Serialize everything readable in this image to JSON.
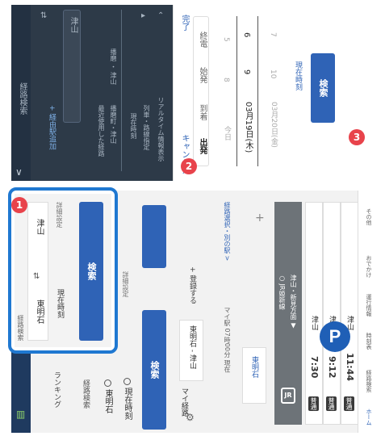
{
  "top": {
    "header_title": "経路検索",
    "add_via_label": "+ 経由駅追加",
    "from_placeholder": "出発",
    "to_value": "津山",
    "recent_label": "最近使用した経路",
    "recent_route": "播磨町・津山",
    "recent_route_time": "播磨 ・ 津山",
    "option_1": "現在時刻",
    "option_2": "列車・路線指定",
    "option_3": "リアルタイム情報表示",
    "sheet": {
      "cancel": "キャンセル",
      "done": "完了",
      "tabs": [
        "出発",
        "到着",
        "始発",
        "終電"
      ],
      "date_prev": "今日",
      "date_selected": "03月19日(木)",
      "date_next": "03月20日(金)",
      "hour_values": [
        "8",
        "9",
        "10"
      ],
      "minute_values": [
        "5",
        "6",
        "7"
      ],
      "hour_prev": "8",
      "hour_sel": "9",
      "min_sel": "6",
      "now_label": "現在時刻",
      "search_button": "検索"
    }
  },
  "bottom": {
    "header": "経路検索",
    "app_logo_text": "ランキング",
    "from_station": "東明石",
    "to_station": "津山",
    "option_time": "現在時刻",
    "detail_setting": "詳細設定",
    "search_button": "検索",
    "my_route_label": "マイ経路",
    "my_route_value": "東明石 - 津山",
    "register_label": "+ 登録する",
    "my_updated": "マイ駅 07時00分 現在",
    "change_label": "経路選択・別の駅 >",
    "station_tag": "東明石",
    "plus": "+",
    "jr_line": "○ JR姫新線",
    "jr_sub": "津山・新見方面 ▼",
    "departures": [
      {
        "tag": "普通",
        "time": "7:30",
        "dest": "津山"
      },
      {
        "tag": "普通",
        "time": "9:12",
        "dest": "津山"
      },
      {
        "tag": "普通",
        "time": "11:44",
        "dest": "津山"
      }
    ],
    "nav": [
      "ホーム",
      "経路検索",
      "時刻表",
      "運行情報",
      "おでかけ",
      "その他"
    ]
  },
  "callout": {
    "title": "経路検索",
    "from": "東明石",
    "to": "津山",
    "time_option": "現在時刻",
    "detail": "詳細設定",
    "search_button": "検索"
  },
  "badges": [
    "1",
    "2",
    "3"
  ],
  "colors": {
    "accent": "#2f63b6",
    "badge": "#e8434b",
    "callout_border": "#1f78d1",
    "dark_bg": "#2d3a48"
  }
}
